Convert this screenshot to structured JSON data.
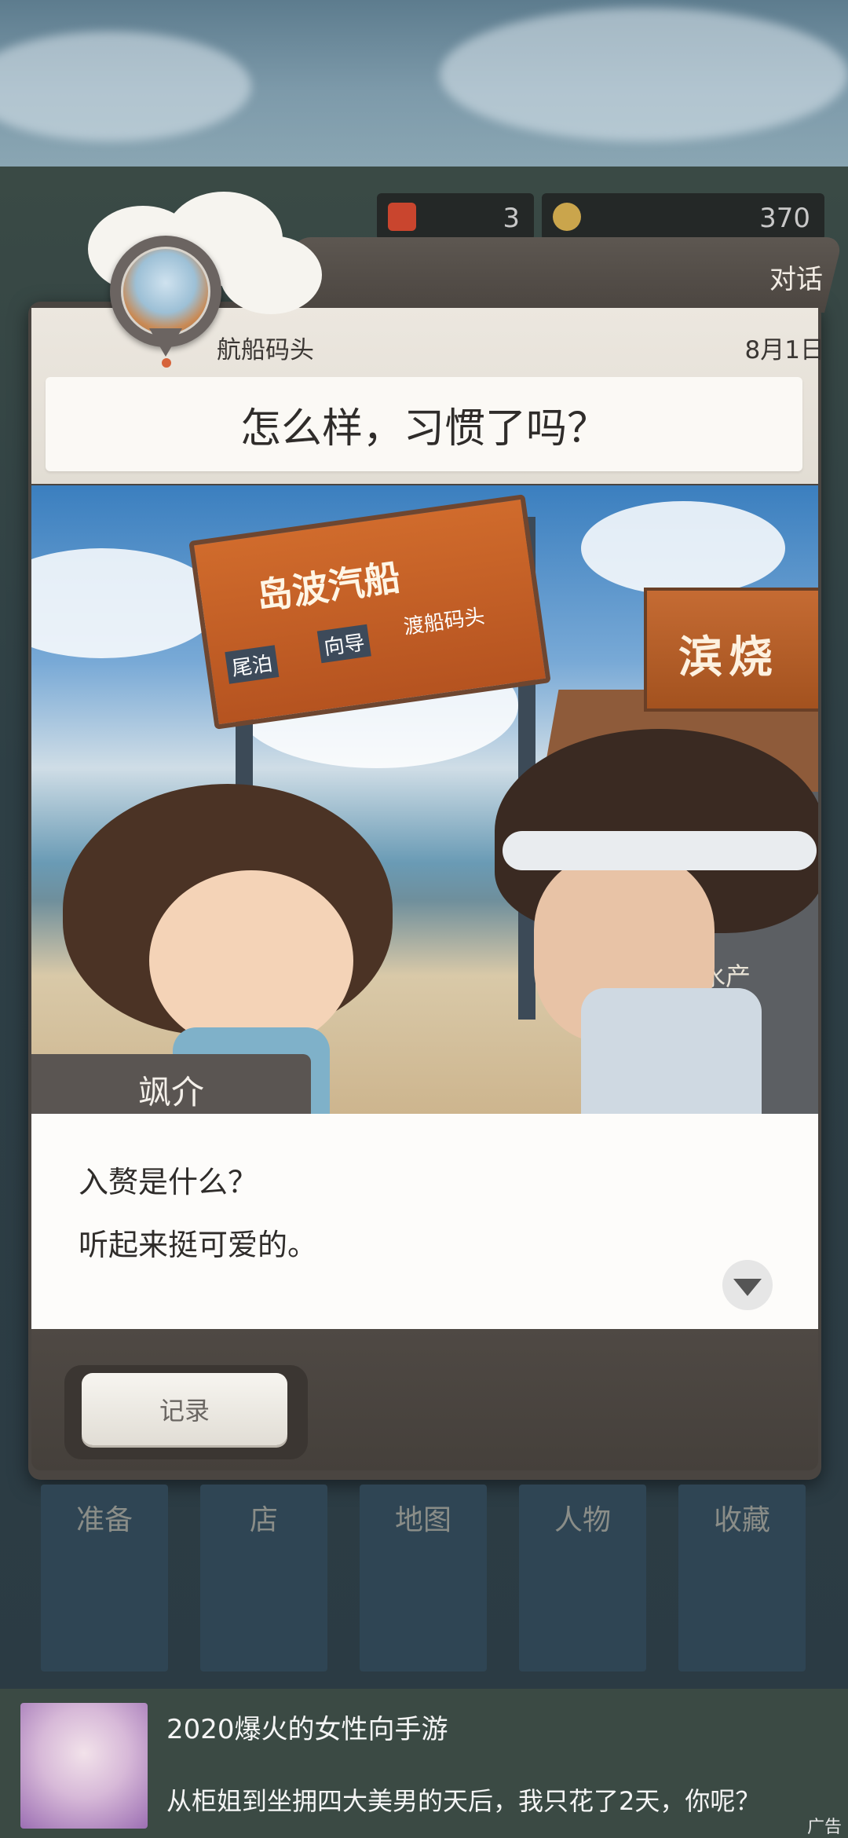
{
  "resources": {
    "item_count": "3",
    "coin_count": "370"
  },
  "dialog": {
    "tab_label": "对话",
    "location": "航船码头",
    "date": "8月1日",
    "question": "怎么样，习惯了吗？",
    "speaker": "飒介",
    "lines": [
      "入赘是什么？",
      "听起来挺可爱的。"
    ],
    "log_button": "记录"
  },
  "scene_text": {
    "sign_main": "岛波汽船",
    "sign_left": "尾泊",
    "sign_mid": "向导",
    "sign_right": "渡船码头",
    "shop_sign": "滨烧",
    "store_text": "道水产"
  },
  "nav": [
    "准备",
    "店",
    "地图",
    "人物",
    "收藏"
  ],
  "ad": {
    "title": "2020爆火的女性向手游",
    "body": "从柜姐到坐拥四大美男的天后，我只花了2天，你呢？",
    "tag": "广告"
  }
}
